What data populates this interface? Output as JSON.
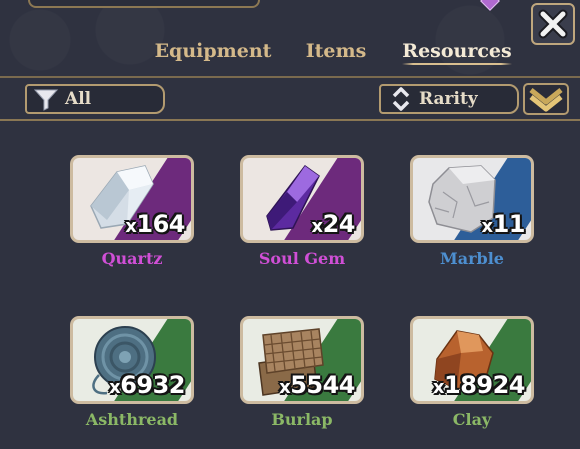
{
  "tabs": [
    {
      "label": "Equipment",
      "active": false
    },
    {
      "label": "Items",
      "active": false
    },
    {
      "label": "Resources",
      "active": true
    }
  ],
  "filter": {
    "label": "All",
    "icon": "funnel-icon"
  },
  "sort": {
    "label": "Rarity",
    "icon": "sort-arrows-icon"
  },
  "order_toggle": {
    "icon": "double-chevron-down-icon"
  },
  "close": {
    "icon": "close-icon"
  },
  "rarity_colors": {
    "epic": "#c64fd0",
    "rare": "#4d8fd0",
    "common": "#8bb866"
  },
  "resources": [
    {
      "name": "Quartz",
      "qty_prefix": "x",
      "qty": "164",
      "rarity": "epic",
      "icon": "quartz-crystal-icon"
    },
    {
      "name": "Soul Gem",
      "qty_prefix": "x",
      "qty": "24",
      "rarity": "epic",
      "icon": "soul-gem-icon"
    },
    {
      "name": "Marble",
      "qty_prefix": "x",
      "qty": "11",
      "rarity": "rare",
      "icon": "marble-block-icon"
    },
    {
      "name": "Ashthread",
      "qty_prefix": "x",
      "qty": "6932",
      "rarity": "common",
      "icon": "thread-spool-icon"
    },
    {
      "name": "Burlap",
      "qty_prefix": "x",
      "qty": "5544",
      "rarity": "common",
      "icon": "burlap-cloth-icon"
    },
    {
      "name": "Clay",
      "qty_prefix": "x",
      "qty": "18924",
      "rarity": "common",
      "icon": "clay-chunk-icon"
    }
  ]
}
